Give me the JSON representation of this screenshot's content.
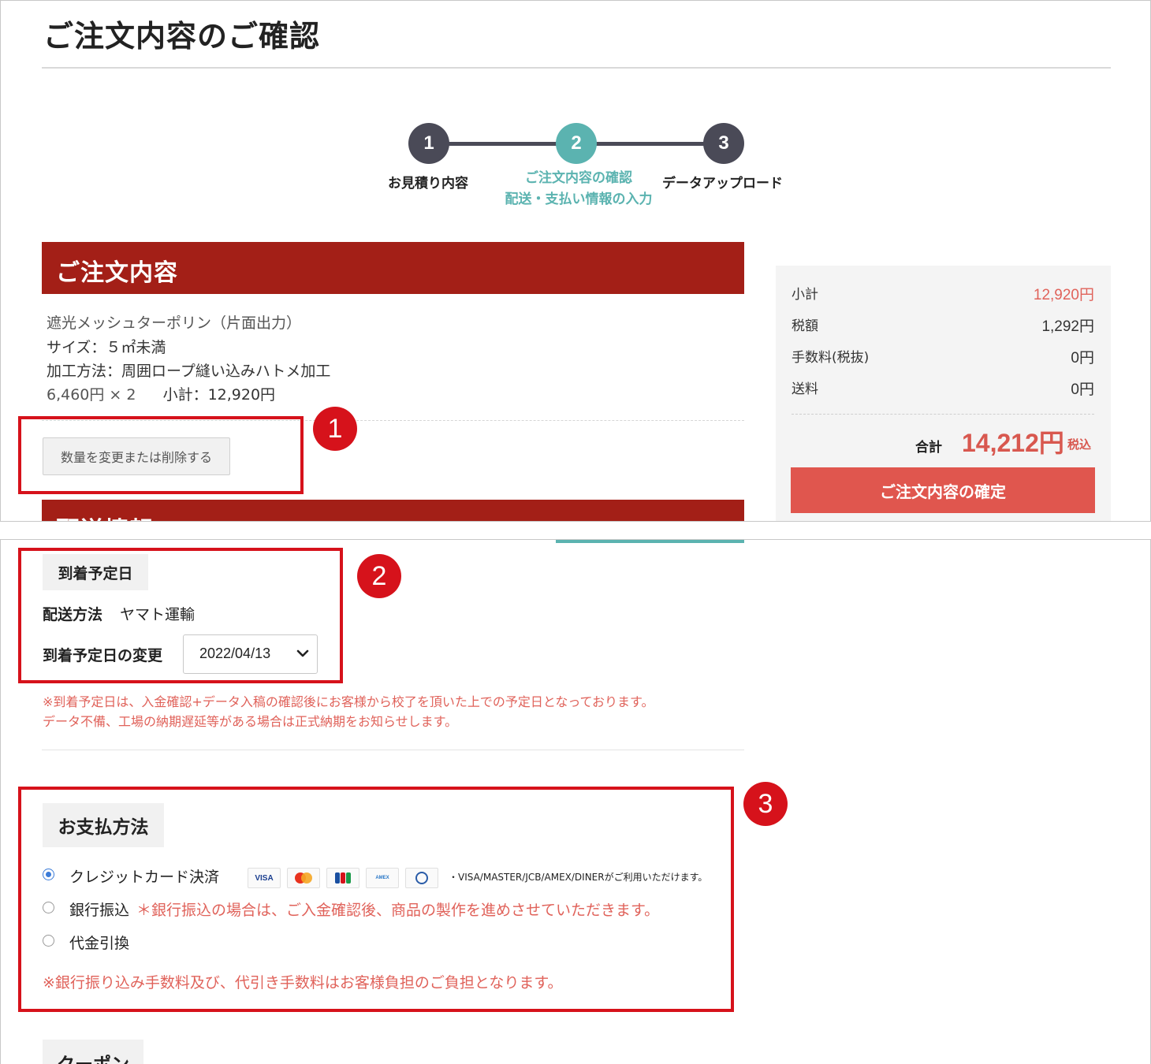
{
  "page": {
    "title": "ご注文内容のご確認"
  },
  "stepper": {
    "steps": [
      {
        "number": "1",
        "label": "お見積り内容",
        "label2": ""
      },
      {
        "number": "2",
        "label": "ご注文内容の確認",
        "label2": "配送・支払い情報の入力"
      },
      {
        "number": "3",
        "label": "データアップロード",
        "label2": ""
      }
    ],
    "active_index": 1
  },
  "order": {
    "section_title": "ご注文内容",
    "product_name": "遮光メッシュターポリン（片面出力）",
    "size": "サイズ：５㎡未満",
    "processing": "加工方法：周囲ロープ縫い込みハトメ加工",
    "price_qty": "6,460円 × 2",
    "subtotal": "小計：12,920円",
    "change_button": "数量を変更または削除する",
    "next_section_title": "配送情報"
  },
  "summary": {
    "rows": [
      {
        "label": "小計",
        "value": "12,920円"
      },
      {
        "label": "税額",
        "value": "1,292円"
      },
      {
        "label": "手数料(税抜)",
        "value": "0円"
      },
      {
        "label": "送料",
        "value": "0円"
      }
    ],
    "total_label": "合計",
    "total_value": "14,212円",
    "total_tax_note": "税込",
    "confirm_button": "ご注文内容の確定"
  },
  "delivery": {
    "arrival_tag": "到着予定日",
    "method_label": "配送方法",
    "method_value": "ヤマト運輸",
    "date_change_label": "到着予定日の変更",
    "date_value": "2022/04/13",
    "note_line1": "※到着予定日は、入金確認+データ入稿の確認後にお客様から校了を頂いた上での予定日となっております。",
    "note_line2": "データ不備、工場の納期遅延等がある場合は正式納期をお知らせします。"
  },
  "payment": {
    "title": "お支払方法",
    "options": [
      {
        "label": "クレジットカード決済",
        "checked": true
      },
      {
        "label": "銀行振込",
        "checked": false
      },
      {
        "label": "代金引換",
        "checked": false
      }
    ],
    "card_logos": [
      "VISA",
      "MASTER",
      "JCB",
      "AMEX",
      "DINERS"
    ],
    "card_note": "・VISA/MASTER/JCB/AMEX/DINERがご利用いただけます。",
    "bank_note": "＊銀行振込の場合は、ご入金確認後、商品の製作を進めさせていただきます。",
    "fee_note": "※銀行振り込み手数料及び、代引き手数料はお客様負担のご負担となります。"
  },
  "coupon": {
    "title": "クーポン"
  },
  "annotations": [
    "1",
    "2",
    "3"
  ],
  "colors": {
    "brand_red": "#a31f17",
    "accent_teal": "#5bb3b0",
    "price_red": "#e0625a",
    "annotation_red": "#d6121b"
  }
}
